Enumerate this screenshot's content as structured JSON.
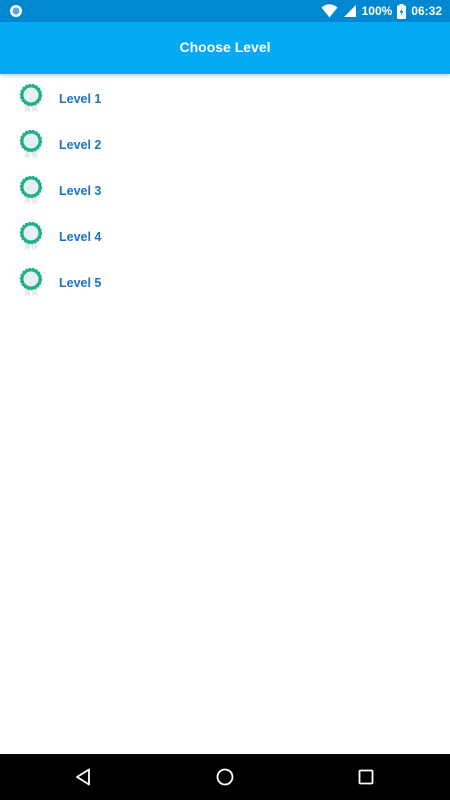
{
  "status_bar": {
    "battery_percent": "100%",
    "time": "06:32",
    "icons": [
      "record-icon",
      "wifi-icon",
      "signal-icon",
      "battery-charging-icon"
    ]
  },
  "app_bar": {
    "title": "Choose Level",
    "color": "#03a9f4"
  },
  "levels": [
    {
      "label": "Level 1",
      "icon": "medal-icon"
    },
    {
      "label": "Level 2",
      "icon": "medal-icon"
    },
    {
      "label": "Level 3",
      "icon": "medal-icon"
    },
    {
      "label": "Level 4",
      "icon": "medal-icon"
    },
    {
      "label": "Level 5",
      "icon": "medal-icon"
    }
  ],
  "nav_bar": {
    "buttons": [
      "back-icon",
      "home-icon",
      "recents-icon"
    ]
  },
  "colors": {
    "status_bar": "#0288d1",
    "label": "#1a73c8",
    "medal": "#1fb08a"
  }
}
